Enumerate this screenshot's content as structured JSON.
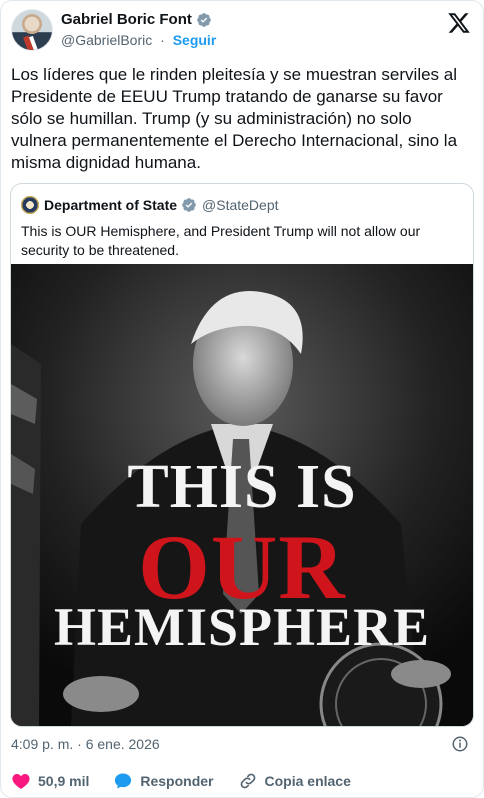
{
  "tweet": {
    "author_name": "Gabriel Boric Font",
    "author_handle": "@GabrielBoric",
    "separator": "·",
    "follow_label": "Seguir",
    "text": "Los líderes que le rinden pleitesía y se muestran serviles al Presidente de EEUU Trump tratando de ganarse su favor sólo se humillan. Trump (y su administración) no solo vulnera permanentemente el Derecho Internacional, sino la misma dignidad humana.",
    "timestamp": "4:09 p. m. · 6 ene. 2026"
  },
  "quote": {
    "author_name": "Department of State",
    "author_handle": "@StateDept",
    "text": "This is OUR Hemisphere, and President Trump will not allow our security to be threatened.",
    "image": {
      "line1": "THIS IS",
      "line2": "OUR",
      "line3": "HEMISPHERE"
    }
  },
  "actions": {
    "likes": "50,9 mil",
    "reply_label": "Responder",
    "copy_label": "Copia enlace"
  },
  "colors": {
    "accent": "#1d9bf0",
    "like": "#f91880",
    "headline_red": "#d0141c"
  },
  "icons": [
    "verified-badge-icon",
    "x-logo-icon",
    "info-icon",
    "heart-icon",
    "reply-bubble-icon",
    "link-icon"
  ]
}
